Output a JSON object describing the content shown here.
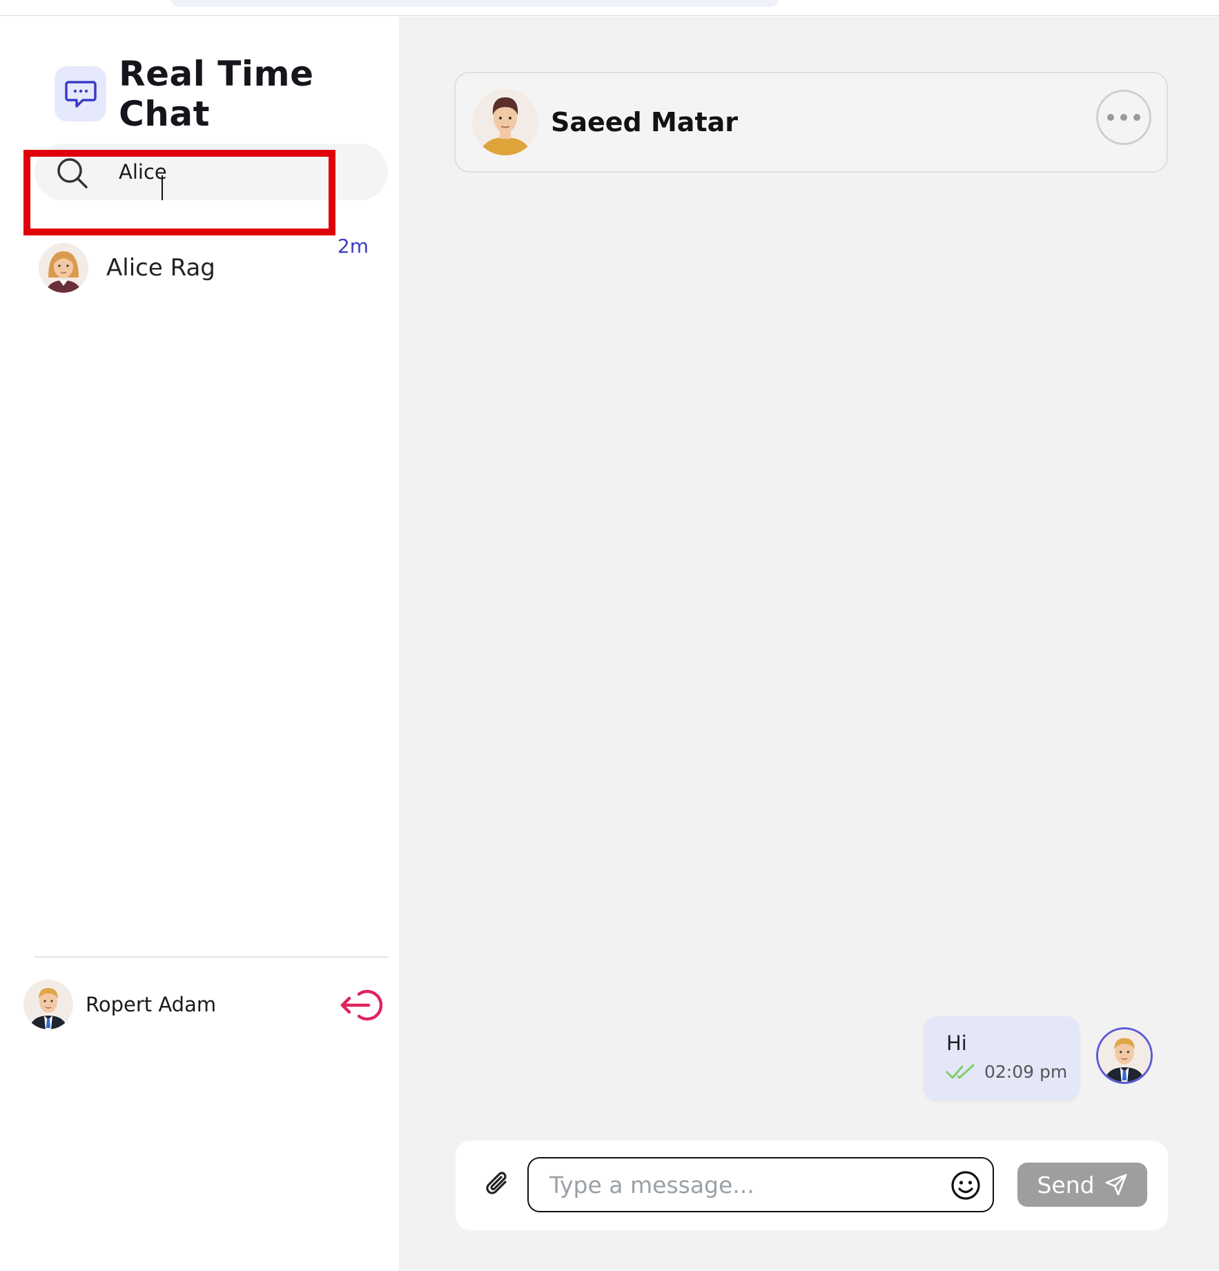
{
  "app": {
    "title": "Real Time Chat"
  },
  "search": {
    "value": "Alice",
    "placeholder": ""
  },
  "contacts": [
    {
      "name": "Alice Rag",
      "time": "2m"
    }
  ],
  "current_user": {
    "name": "Ropert Adam"
  },
  "chat": {
    "peer_name": "Saeed Matar",
    "messages": [
      {
        "text": "Hi",
        "time": "02:09 pm",
        "status": "read"
      }
    ]
  },
  "composer": {
    "placeholder": "Type a message...",
    "send_label": "Send"
  },
  "icons": {
    "brand": "chat-bubble-icon",
    "search": "search-icon",
    "more": "more-horizontal-icon",
    "attach": "paperclip-icon",
    "emoji": "smiley-icon",
    "send": "send-arrow-icon",
    "logout": "logout-icon",
    "read": "double-check-icon"
  },
  "colors": {
    "accent": "#3b3bc4",
    "highlight": "#e0000a",
    "logout": "#e0245e",
    "check": "#7fcf6a",
    "bubble": "#e3e7f8",
    "send_button": "#9e9e9e"
  }
}
